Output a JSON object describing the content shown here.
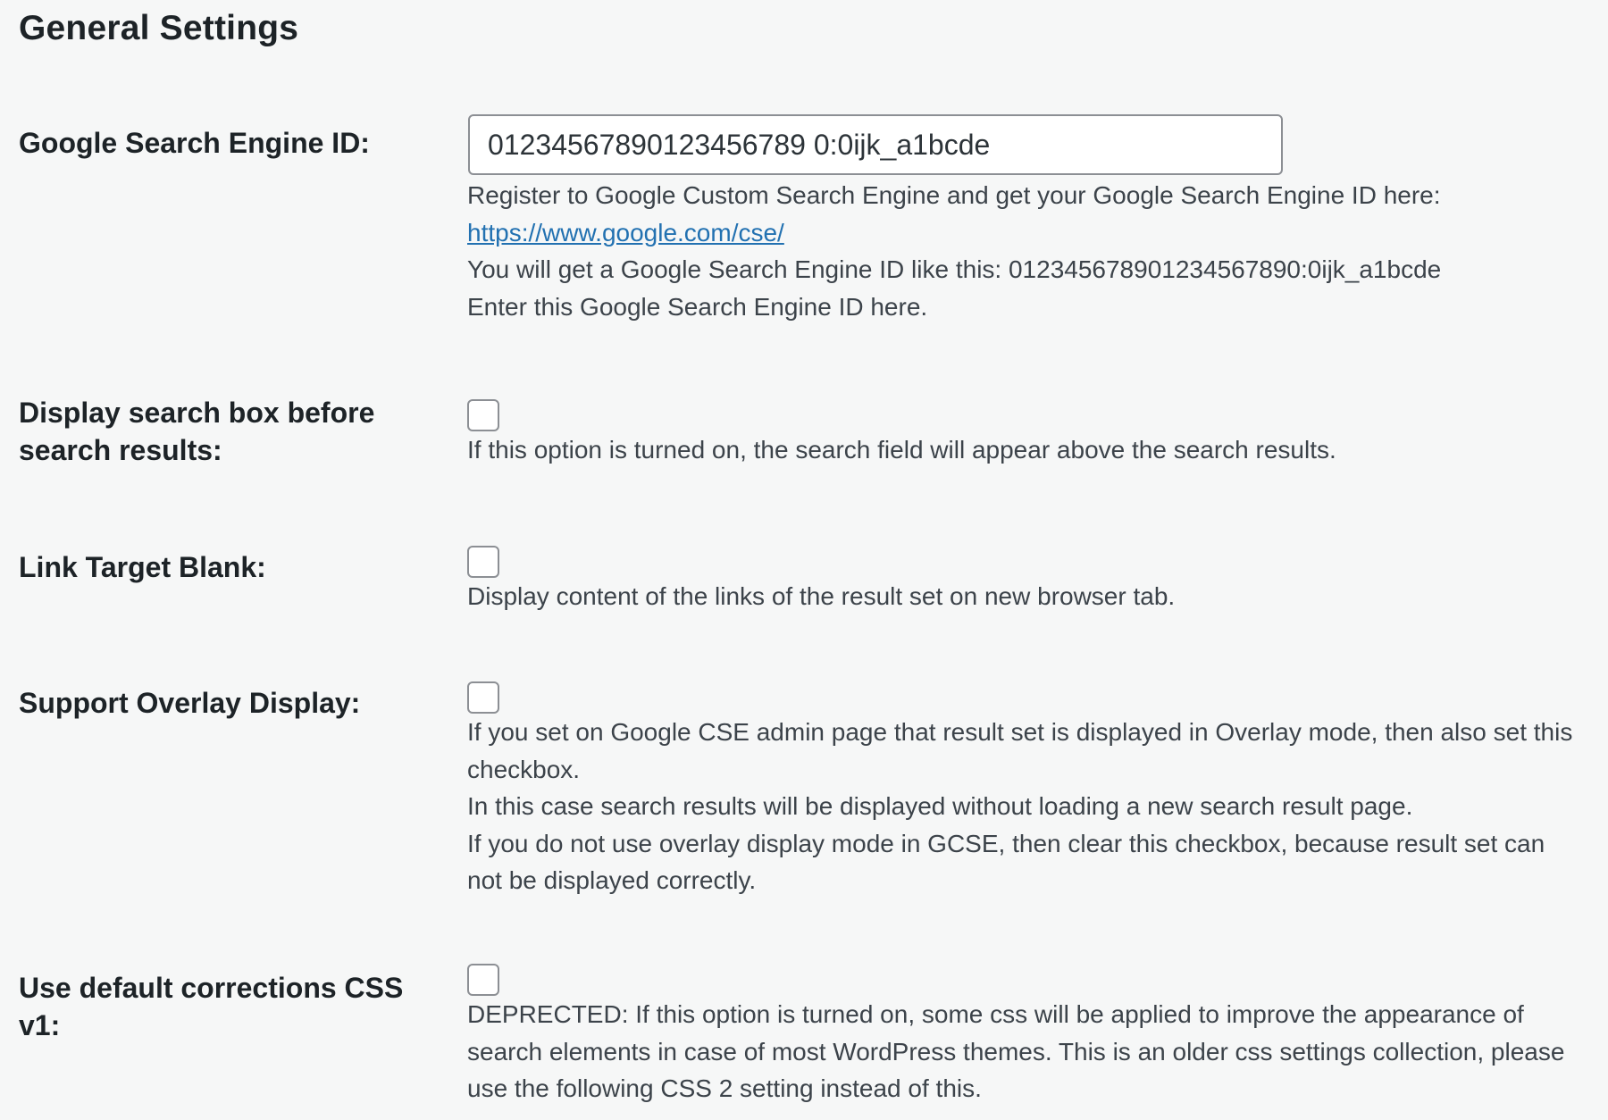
{
  "page": {
    "title": "General Settings"
  },
  "settings": {
    "engine_id": {
      "label": "Google Search Engine ID:",
      "value": "01234567890123456789 0:0ijk_a1bcde",
      "desc_line1": "Register to Google Custom Search Engine and get your Google Search Engine ID here:",
      "link_text": "https://www.google.com/cse/",
      "desc_line3": "You will get a Google Search Engine ID like this: 012345678901234567890:0ijk_a1bcde",
      "desc_line4": "Enter this Google Search Engine ID here."
    },
    "search_box_before": {
      "label_line1": "Display search box before",
      "label_line2": "search results:",
      "checked": false,
      "desc": "If this option is turned on, the search field will appear above the search results."
    },
    "link_target_blank": {
      "label": "Link Target Blank:",
      "checked": false,
      "desc": "Display content of the links of the result set on new browser tab."
    },
    "overlay_display": {
      "label": "Support Overlay Display:",
      "checked": false,
      "desc_line1": "If you set on Google CSE admin page that result set is displayed in Overlay mode, then also set this checkbox.",
      "desc_line2": "In this case search results will be displayed without loading a new search result page.",
      "desc_line3": "If you do not use overlay display mode in GCSE, then clear this checkbox, because result set can not be displayed correctly."
    },
    "default_css_v1": {
      "label_line1": "Use default corrections CSS",
      "label_line2": "v1:",
      "checked": false,
      "desc": "DEPRECTED: If this option is turned on, some css will be applied to improve the appearance of search elements in case of most WordPress themes. This is an older css settings collection, please use the following CSS 2 setting instead of this."
    }
  },
  "colors": {
    "background": "#f6f7f7",
    "text": "#1d2327",
    "description": "#3c434a",
    "link": "#2271b1",
    "input_border": "#8c8f94"
  }
}
